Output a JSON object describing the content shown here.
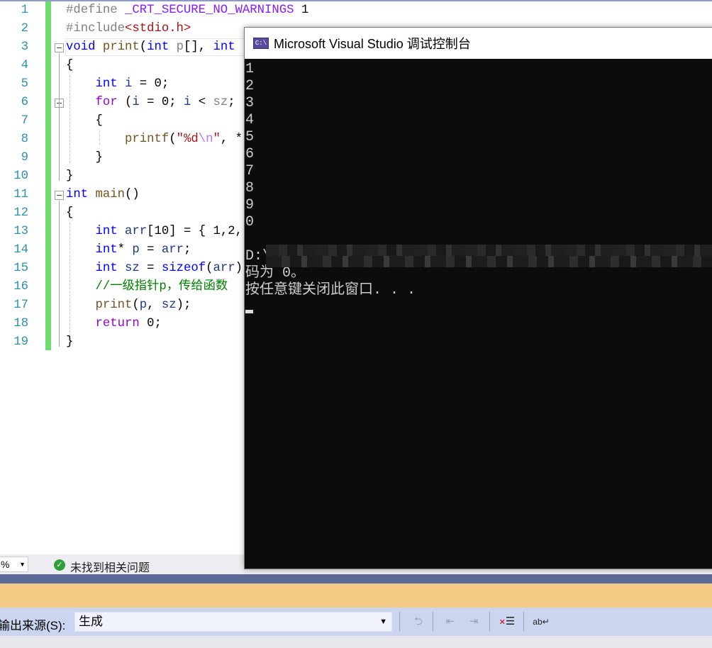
{
  "editor": {
    "line_numbers": [
      "1",
      "2",
      "3",
      "4",
      "5",
      "6",
      "7",
      "8",
      "9",
      "10",
      "11",
      "12",
      "13",
      "14",
      "15",
      "16",
      "17",
      "18",
      "19"
    ],
    "lines": [
      [
        [
          "pp",
          "#define "
        ],
        [
          "macro",
          "_CRT_SECURE_NO_WARNINGS"
        ],
        [
          "plain",
          " 1"
        ]
      ],
      [
        [
          "pp",
          "#include"
        ],
        [
          "inc",
          "<stdio.h>"
        ]
      ],
      [
        [
          "kw",
          "void"
        ],
        [
          "plain",
          " "
        ],
        [
          "fn",
          "print"
        ],
        [
          "plain",
          "("
        ],
        [
          "kw",
          "int"
        ],
        [
          "plain",
          " "
        ],
        [
          "param",
          "p"
        ],
        [
          "plain",
          "[], "
        ],
        [
          "kw",
          "int"
        ]
      ],
      [
        [
          "plain",
          "{"
        ]
      ],
      [
        [
          "plain",
          "    "
        ],
        [
          "kw",
          "int"
        ],
        [
          "plain",
          " "
        ],
        [
          "var",
          "i"
        ],
        [
          "plain",
          " = 0;"
        ]
      ],
      [
        [
          "plain",
          "    "
        ],
        [
          "ctl",
          "for"
        ],
        [
          "plain",
          " ("
        ],
        [
          "var",
          "i"
        ],
        [
          "plain",
          " = 0; "
        ],
        [
          "var",
          "i"
        ],
        [
          "plain",
          " < "
        ],
        [
          "param",
          "sz"
        ],
        [
          "plain",
          ";"
        ]
      ],
      [
        [
          "plain",
          "    {"
        ]
      ],
      [
        [
          "plain",
          "        "
        ],
        [
          "fn",
          "printf"
        ],
        [
          "plain",
          "("
        ],
        [
          "str",
          "\"%d"
        ],
        [
          "esc",
          "\\n"
        ],
        [
          "str",
          "\""
        ],
        [
          "plain",
          ", *"
        ]
      ],
      [
        [
          "plain",
          "    }"
        ]
      ],
      [
        [
          "plain",
          "}"
        ]
      ],
      [
        [
          "kw",
          "int"
        ],
        [
          "plain",
          " "
        ],
        [
          "fn",
          "main"
        ],
        [
          "plain",
          "()"
        ]
      ],
      [
        [
          "plain",
          "{"
        ]
      ],
      [
        [
          "plain",
          "    "
        ],
        [
          "kw",
          "int"
        ],
        [
          "plain",
          " "
        ],
        [
          "var",
          "arr"
        ],
        [
          "plain",
          "[10] = { 1,2,"
        ]
      ],
      [
        [
          "plain",
          "    "
        ],
        [
          "kw",
          "int"
        ],
        [
          "plain",
          "* "
        ],
        [
          "var",
          "p"
        ],
        [
          "plain",
          " = "
        ],
        [
          "var",
          "arr"
        ],
        [
          "plain",
          ";"
        ]
      ],
      [
        [
          "plain",
          "    "
        ],
        [
          "kw",
          "int"
        ],
        [
          "plain",
          " "
        ],
        [
          "var",
          "sz"
        ],
        [
          "plain",
          " = "
        ],
        [
          "kw",
          "sizeof"
        ],
        [
          "plain",
          "("
        ],
        [
          "var",
          "arr"
        ],
        [
          "plain",
          ")"
        ]
      ],
      [
        [
          "plain",
          "    "
        ],
        [
          "cm",
          "//一级指针p，传给函数"
        ]
      ],
      [
        [
          "plain",
          "    "
        ],
        [
          "fn",
          "print"
        ],
        [
          "plain",
          "("
        ],
        [
          "var",
          "p"
        ],
        [
          "plain",
          ", "
        ],
        [
          "var",
          "sz"
        ],
        [
          "plain",
          ");"
        ]
      ],
      [
        [
          "plain",
          "    "
        ],
        [
          "ctl",
          "return"
        ],
        [
          "plain",
          " 0;"
        ]
      ],
      [
        [
          "plain",
          "}"
        ]
      ]
    ]
  },
  "console": {
    "icon": "console-app-icon",
    "icon_text": "C:\\",
    "title": "Microsoft Visual Studio 调试控制台",
    "output_lines": [
      "1",
      "2",
      "3",
      "4",
      "5",
      "6",
      "7",
      "8",
      "9",
      "0",
      ""
    ],
    "path_prefix": "D:\\",
    "exit_line": "码为 0。",
    "prompt_line": "按任意键关闭此窗口. . ."
  },
  "status": {
    "zoom_value": "%",
    "issues_icon": "check-circle-icon",
    "issues_text": "未找到相关问题"
  },
  "output_toolbar": {
    "source_label": "输出来源(S):",
    "source_value": "生成",
    "buttons": [
      "go-to-error-icon",
      "previous-message-icon",
      "next-message-icon",
      "clear-all-icon",
      "word-wrap-icon"
    ]
  },
  "colors": {
    "keyword": "#0000ff",
    "control": "#8f08c4",
    "function": "#74531f",
    "comment": "#008000",
    "string": "#a31515",
    "console_bg": "#0c0c0c",
    "change_bar": "#6fdc6f",
    "orange_bar": "#f3cb85"
  }
}
